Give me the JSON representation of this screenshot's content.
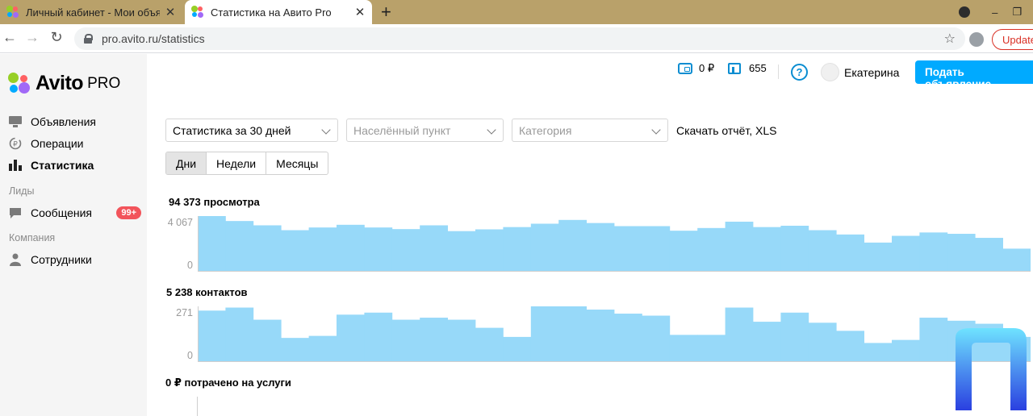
{
  "browser": {
    "tabs": [
      {
        "label": "Личный кабинет - Мои объявлени",
        "active": false
      },
      {
        "label": "Статистика на Авито Pro",
        "active": true
      }
    ],
    "new_tab": "+",
    "url": "pro.avito.ru/statistics",
    "update_label": "Update",
    "win_minimize": "–",
    "win_restore": "❐"
  },
  "sidebar": {
    "logo_word": "Avito",
    "logo_pro": "PRO",
    "items": [
      {
        "label": "Объявления",
        "icon": "monitor-icon"
      },
      {
        "label": "Операции",
        "icon": "refresh-coin-icon"
      },
      {
        "label": "Статистика",
        "icon": "bar-chart-icon",
        "active": true
      }
    ],
    "section_leads": "Лиды",
    "messages": {
      "label": "Сообщения",
      "badge": "99+"
    },
    "section_company": "Компания",
    "staff": {
      "label": "Сотрудники"
    }
  },
  "header": {
    "balance": "0 ₽",
    "bonuses": "655",
    "help": "?",
    "user_name": "Екатерина",
    "post_button": "Подать объявление"
  },
  "filters": {
    "period": "Статистика за 30 дней",
    "location_placeholder": "Населённый пункт",
    "category_placeholder": "Категория",
    "download": "Скачать отчёт, XLS",
    "granularity": [
      "Дни",
      "Недели",
      "Месяцы"
    ],
    "granularity_active": 0
  },
  "colors": {
    "accent": "#00aaff",
    "bar": "#97d9f9",
    "badge": "#f2545b"
  },
  "chart_data": [
    {
      "type": "bar",
      "title": "94 373 просмотра",
      "ylim": [
        0,
        4067
      ],
      "yticks": [
        "4 067",
        "0"
      ],
      "values": [
        4067,
        3700,
        3380,
        3020,
        3220,
        3420,
        3220,
        3100,
        3380,
        2950,
        3080,
        3250,
        3500,
        3780,
        3550,
        3320,
        3320,
        2980,
        3180,
        3650,
        3250,
        3350,
        3020,
        2700,
        2100,
        2600,
        2850,
        2750,
        2450,
        1650
      ]
    },
    {
      "type": "bar",
      "title": "5 238 контактов",
      "ylim": [
        0,
        271
      ],
      "yticks": [
        "271",
        "0"
      ],
      "values": [
        250,
        265,
        205,
        115,
        125,
        230,
        240,
        205,
        215,
        205,
        165,
        120,
        290,
        320,
        255,
        235,
        225,
        130,
        130,
        265,
        195,
        240,
        190,
        150,
        90,
        105,
        215,
        200,
        185,
        120
      ]
    },
    {
      "type": "bar",
      "title": "0 ₽ потрачено на услуги",
      "values": []
    }
  ]
}
